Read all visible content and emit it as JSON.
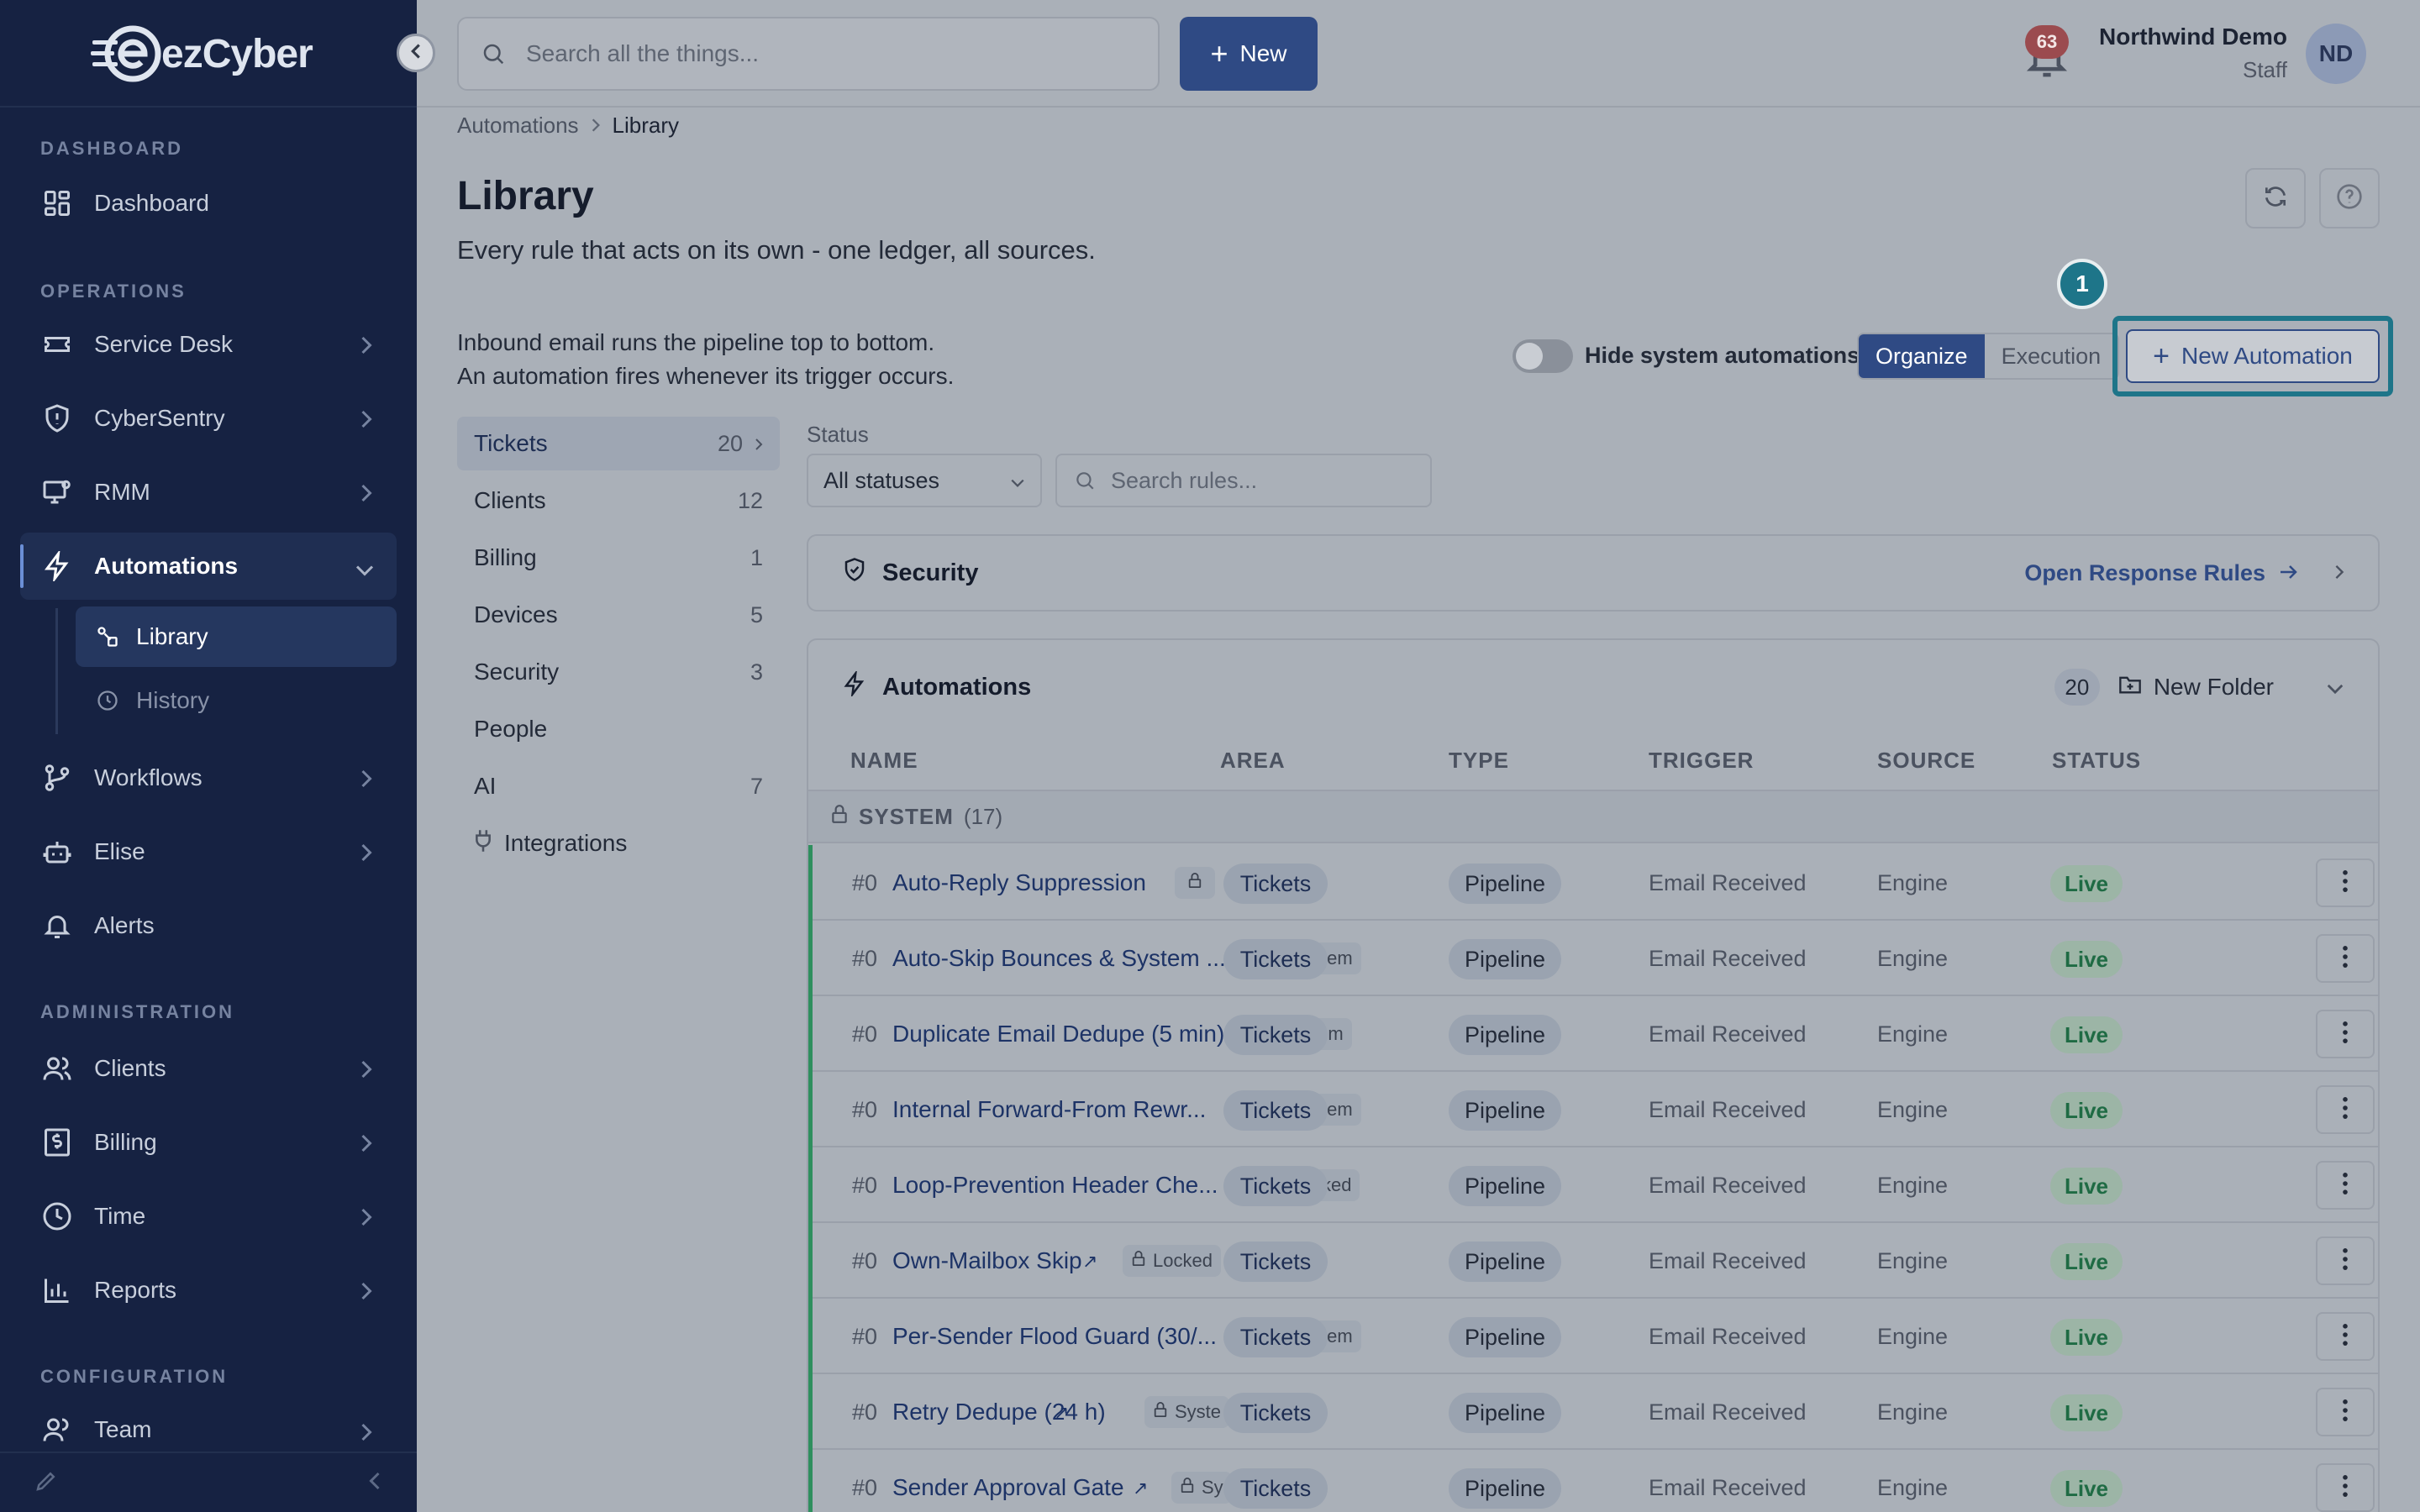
{
  "app": {
    "logo_text_a": "ez",
    "logo_text_b": "Cyber"
  },
  "sidebar": {
    "sections": {
      "dashboard": "DASHBOARD",
      "operations": "OPERATIONS",
      "administration": "ADMINISTRATION",
      "configuration": "CONFIGURATION"
    },
    "items": {
      "dashboard": "Dashboard",
      "service_desk": "Service Desk",
      "cybersentry": "CyberSentry",
      "rmm": "RMM",
      "automations": "Automations",
      "library": "Library",
      "history": "History",
      "workflows": "Workflows",
      "elise": "Elise",
      "alerts": "Alerts",
      "clients": "Clients",
      "billing": "Billing",
      "time": "Time",
      "reports": "Reports",
      "team": "Team"
    }
  },
  "topbar": {
    "search_placeholder": "Search all the things...",
    "new_label": "New",
    "notif_count": "63",
    "user_name": "Northwind Demo",
    "user_role": "Staff",
    "avatar_initials": "ND"
  },
  "breadcrumb": {
    "parent": "Automations",
    "current": "Library"
  },
  "page": {
    "title": "Library",
    "subtitle": "Every rule that acts on its own - one ledger, all sources.",
    "info_line1": "Inbound email runs the pipeline top to bottom.",
    "info_line2": "An automation fires whenever its trigger occurs.",
    "hide_system_label": "Hide system automations",
    "seg_organize": "Organize",
    "seg_execution": "Execution",
    "step_badge": "1",
    "new_automation": "New Automation"
  },
  "categories": [
    {
      "label": "Tickets",
      "count": "20"
    },
    {
      "label": "Clients",
      "count": "12"
    },
    {
      "label": "Billing",
      "count": "1"
    },
    {
      "label": "Devices",
      "count": "5"
    },
    {
      "label": "Security",
      "count": "3"
    },
    {
      "label": "People",
      "count": ""
    },
    {
      "label": "AI",
      "count": "7"
    },
    {
      "label": "Integrations",
      "count": ""
    }
  ],
  "filters": {
    "status_label": "Status",
    "status_value": "All statuses",
    "search_placeholder": "Search rules..."
  },
  "security_card": {
    "title": "Security",
    "link": "Open Response Rules"
  },
  "automations_card": {
    "title": "Automations",
    "count": "20",
    "new_folder": "New Folder",
    "columns": {
      "name": "NAME",
      "area": "AREA",
      "type": "TYPE",
      "trigger": "TRIGGER",
      "source": "SOURCE",
      "status": "STATUS"
    },
    "group": {
      "label": "SYSTEM",
      "count": "(17)"
    },
    "rows": [
      {
        "num": "#0",
        "name": "Auto-Reply Suppression",
        "tag": "",
        "area": "Tickets",
        "type": "Pipeline",
        "trigger": "Email Received",
        "source": "Engine",
        "status": "Live"
      },
      {
        "num": "#0",
        "name": "Auto-Skip Bounces & System ...",
        "tag": "stem",
        "area": "Tickets",
        "type": "Pipeline",
        "trigger": "Email Received",
        "source": "Engine",
        "status": "Live"
      },
      {
        "num": "#0",
        "name": "Duplicate Email Dedupe (5 min)",
        "tag": "tem",
        "area": "Tickets",
        "type": "Pipeline",
        "trigger": "Email Received",
        "source": "Engine",
        "status": "Live"
      },
      {
        "num": "#0",
        "name": "Internal Forward-From Rewr...",
        "tag": "stem",
        "area": "Tickets",
        "type": "Pipeline",
        "trigger": "Email Received",
        "source": "Engine",
        "status": "Live"
      },
      {
        "num": "#0",
        "name": "Loop-Prevention Header Che...",
        "tag": "cked",
        "area": "Tickets",
        "type": "Pipeline",
        "trigger": "Email Received",
        "source": "Engine",
        "status": "Live"
      },
      {
        "num": "#0",
        "name": "Own-Mailbox Skip",
        "tag": "Locked",
        "area": "Tickets",
        "type": "Pipeline",
        "trigger": "Email Received",
        "source": "Engine",
        "status": "Live"
      },
      {
        "num": "#0",
        "name": "Per-Sender Flood Guard (30/...",
        "tag": "stem",
        "area": "Tickets",
        "type": "Pipeline",
        "trigger": "Email Received",
        "source": "Engine",
        "status": "Live"
      },
      {
        "num": "#0",
        "name": "Retry Dedupe (24 h)",
        "tag": "Syste",
        "area": "Tickets",
        "type": "Pipeline",
        "trigger": "Email Received",
        "source": "Engine",
        "status": "Live"
      },
      {
        "num": "#0",
        "name": "Sender Approval Gate",
        "tag": "Sy",
        "area": "Tickets",
        "type": "Pipeline",
        "trigger": "Email Received",
        "source": "Engine",
        "status": "Live"
      }
    ]
  }
}
